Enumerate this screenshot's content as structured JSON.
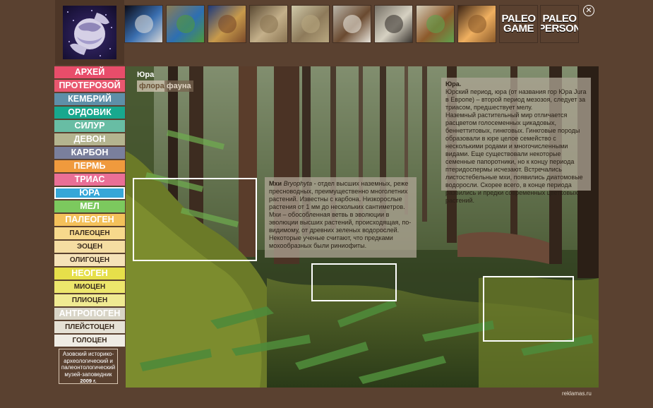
{
  "header": {
    "logo_icon": "globe-hands-logo",
    "thumbnails": [
      {
        "name": "earth-globe-thumb",
        "kind": "image",
        "colors": [
          "#0b0b16",
          "#3a6fb0",
          "#d8d8d8"
        ]
      },
      {
        "name": "twin-globes-thumb",
        "kind": "image",
        "colors": [
          "#8a7d56",
          "#2d6fb2",
          "#4e9a3c"
        ]
      },
      {
        "name": "world-map-thumb",
        "kind": "image",
        "colors": [
          "#1e3a7b",
          "#c89a4b",
          "#7a4a2a"
        ]
      },
      {
        "name": "ammonite-thumb",
        "kind": "image",
        "colors": [
          "#5b4a33",
          "#c4b08a",
          "#8a7452"
        ]
      },
      {
        "name": "elephant-ancestor-thumb",
        "kind": "image",
        "colors": [
          "#cfc8a8",
          "#8d7a5a",
          "#b8a77f"
        ]
      },
      {
        "name": "mammoth-thumb",
        "kind": "image",
        "colors": [
          "#b9b4a8",
          "#6a4a30",
          "#e8e4da"
        ]
      },
      {
        "name": "skeleton-photo-thumb",
        "kind": "image",
        "colors": [
          "#777166",
          "#d6d1c2",
          "#3a3530"
        ]
      },
      {
        "name": "mammoth-diorama-thumb",
        "kind": "image",
        "colors": [
          "#d4cdb8",
          "#8d5a2c",
          "#5fa24d"
        ]
      },
      {
        "name": "museum-hall-thumb",
        "kind": "image",
        "colors": [
          "#3d2515",
          "#f0b060",
          "#8a5a2a"
        ]
      },
      {
        "name": "display-case-thumb",
        "kind": "image",
        "colors": [
          "#4a3020",
          "#d8c8a8",
          "#9a7048"
        ]
      }
    ],
    "text_tiles": [
      {
        "name": "paleo-game-tile",
        "label": "PALEO\nGAME"
      },
      {
        "name": "paleo-person-tile",
        "label": "PALEO\nPERSON"
      }
    ],
    "close_glyph": "✕"
  },
  "sidebar": {
    "items": [
      {
        "label": "АРХЕЙ",
        "color": "#e84d6a",
        "sub": false
      },
      {
        "label": "ПРОТЕРОЗОЙ",
        "color": "#e8576f",
        "sub": false
      },
      {
        "label": "КЕМБРИЙ",
        "color": "#5e8fa8",
        "sub": false
      },
      {
        "label": "ОРДОВИК",
        "color": "#18a88e",
        "sub": false
      },
      {
        "label": "СИЛУР",
        "color": "#68bda4",
        "sub": false
      },
      {
        "label": "ДЕВОН",
        "color": "#b4b48f",
        "sub": false
      },
      {
        "label": "КАРБОН",
        "color": "#7a7f9c",
        "sub": false
      },
      {
        "label": "ПЕРМЬ",
        "color": "#f09a3d",
        "sub": false
      },
      {
        "label": "ТРИАС",
        "color": "#ea6f96",
        "sub": false
      },
      {
        "label": "ЮРА",
        "color": "#36a7d8",
        "sub": false,
        "active": true
      },
      {
        "label": "МЕЛ",
        "color": "#7cc95e",
        "sub": false
      },
      {
        "label": "ПАЛЕОГЕН",
        "color": "#f4c15a",
        "sub": false
      },
      {
        "label": "ПАЛЕОЦЕН",
        "color": "#f7d98c",
        "sub": true
      },
      {
        "label": "ЭОЦЕН",
        "color": "#f5dda2",
        "sub": true
      },
      {
        "label": "ОЛИГОЦЕН",
        "color": "#f5e2b8",
        "sub": true
      },
      {
        "label": "НЕОГЕН",
        "color": "#e6df4a",
        "sub": false
      },
      {
        "label": "МИОЦЕН",
        "color": "#ede66c",
        "sub": true
      },
      {
        "label": "ПЛИОЦЕН",
        "color": "#f0ea92",
        "sub": true
      },
      {
        "label": "АНТРОПОГЕН",
        "color": "#d8d4c6",
        "sub": false
      },
      {
        "label": "ПЛЕЙСТОЦЕН",
        "color": "#e6e2d6",
        "sub": true
      },
      {
        "label": "ГОЛОЦЕН",
        "color": "#efece4",
        "sub": true
      }
    ],
    "museum_text": "Азовский историко-археологический и палеонтологический музей-заповедник",
    "museum_year": "2009 г."
  },
  "scene": {
    "title": "Юра",
    "tabs": [
      "флора",
      "фауна"
    ],
    "jura_info": {
      "heading": "Юра.",
      "text": "Юрский период, юра (от названия гор Юра Jura в Европе) – второй период мезозоя, следует за триасом, предшествует мелу.\nНаземный растительный мир отличается расцветом голосеменных цикадовых, беннеттитовых, гинкговых. Гинкговые породы образовали в юре целое семейство с несколькими родами и многочисленными видами. Еще существовали некоторые семенные папоротники, но к концу периода птеридоспермы исчезают. Встречались листостебельные мхи, появились диатомовые водоросли. Скорее всего, в конце периода развились и предки современных цветковых растений."
    },
    "moss_info": {
      "term": "Мхи",
      "latin": "Bryophyta",
      "text": " - отдел высших наземных, реже пресноводных, преимущественно многолетних растений. Известны с карбона.  Низкорослые растения от 1 мм до нескольких сантиметров. Мхи – обособленная ветвь в эволюции в эволюции высших растений, происходящая, по-видимому, от древних зеленых водорослей. Некоторые ученые считают, что  предками мохообразных были риниофиты."
    }
  },
  "footer": {
    "credit": "reklamas.ru"
  }
}
